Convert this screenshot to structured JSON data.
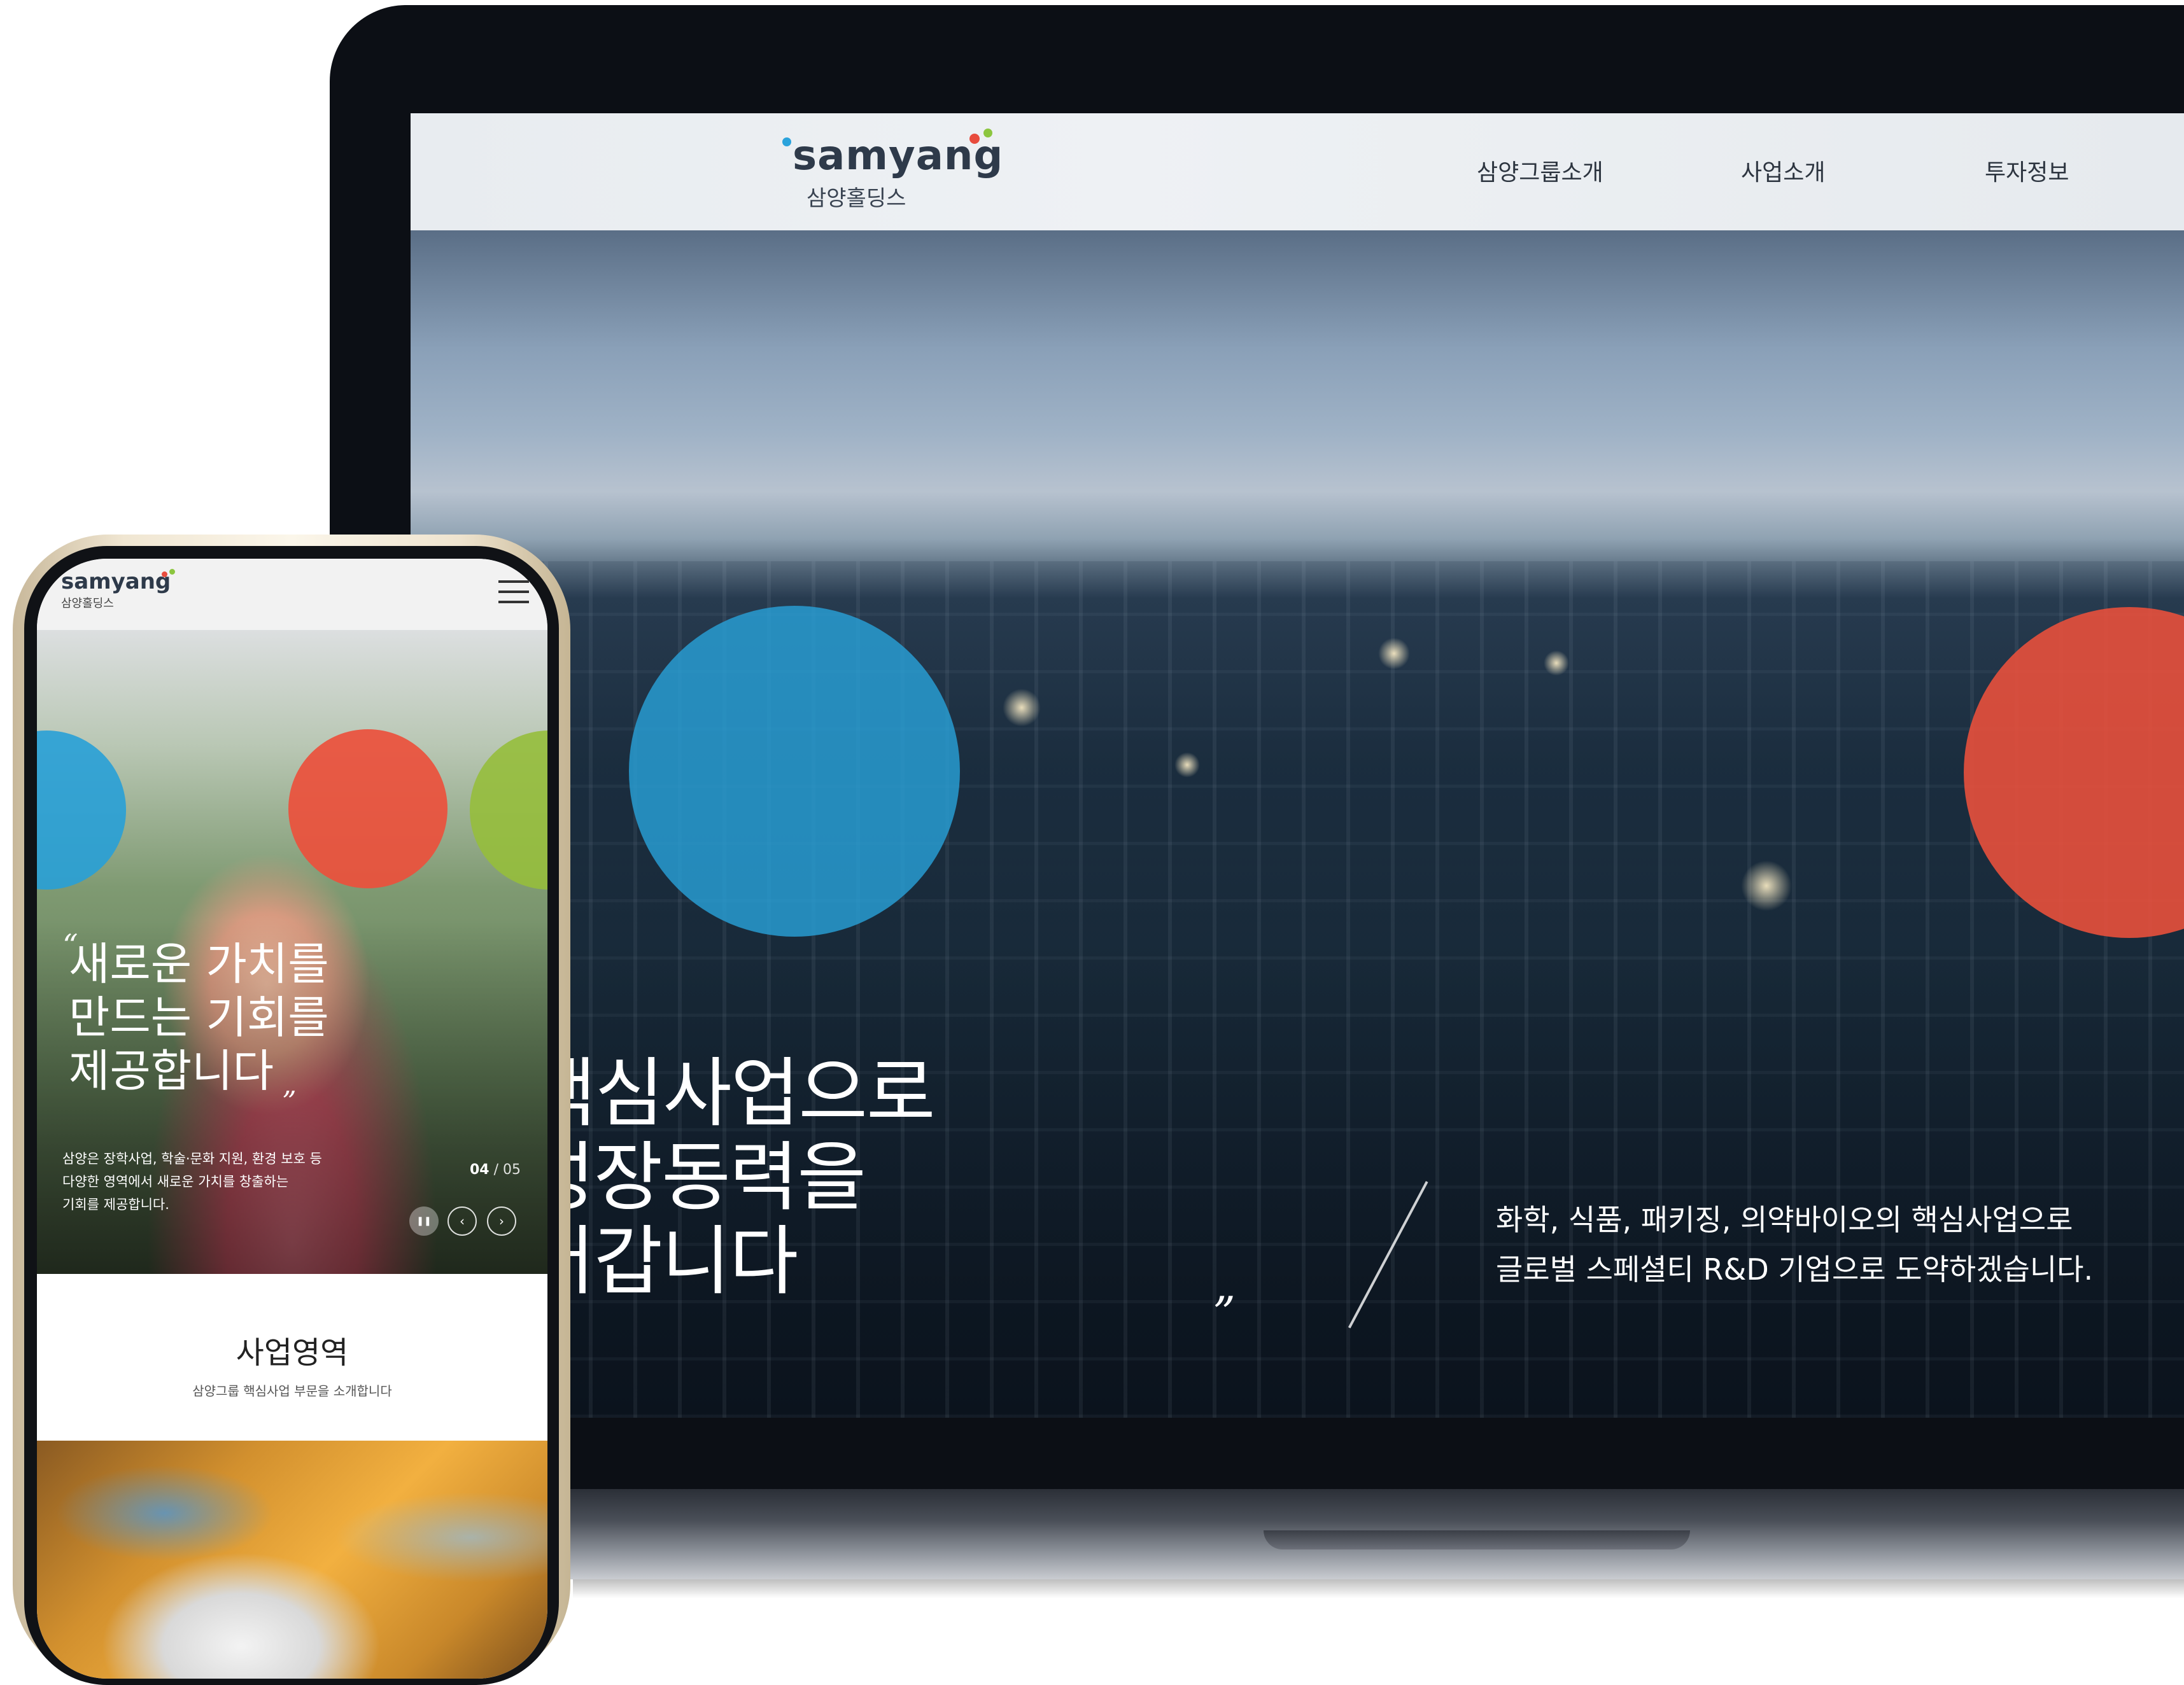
{
  "brand": {
    "name": "samyang",
    "subtitle": "삼양홀딩스",
    "dot_colors": [
      "#2aa3dc",
      "#e84c3d",
      "#8cc63f"
    ]
  },
  "desktop": {
    "nav": [
      "삼양그룹소개",
      "사업소개",
      "투자정보"
    ],
    "hero": {
      "quote_open": "“",
      "quote_close": "”",
      "headline_lines": [
        "4대 핵심사업으로",
        "미래성장동력을",
        "만들어갑니다"
      ],
      "description_lines": [
        "화학, 식품, 패키징, 의약바이오의 핵심사업으로",
        "글로벌 스페셜티 R&D 기업으로 도약하겠습니다."
      ]
    }
  },
  "mobile": {
    "menu_icon": "hamburger-icon",
    "hero": {
      "quote_open": "“",
      "quote_close": "”",
      "headline_lines": [
        "새로운 가치를",
        "만드는 기회를",
        "제공합니다"
      ],
      "description_lines": [
        "삼양은 장학사업, 학술·문화 지원, 환경 보호 등",
        "다양한 영역에서 새로운 가치를 창출하는",
        "기회를 제공합니다."
      ],
      "counter_current": "04",
      "counter_separator": "/",
      "counter_total": "05",
      "controls": {
        "pause": "pause-icon",
        "prev": "chevron-left-icon",
        "next": "chevron-right-icon"
      }
    },
    "section": {
      "title": "사업영역",
      "subtitle": "삼양그룹 핵심사업 부문을 소개합니다"
    }
  }
}
